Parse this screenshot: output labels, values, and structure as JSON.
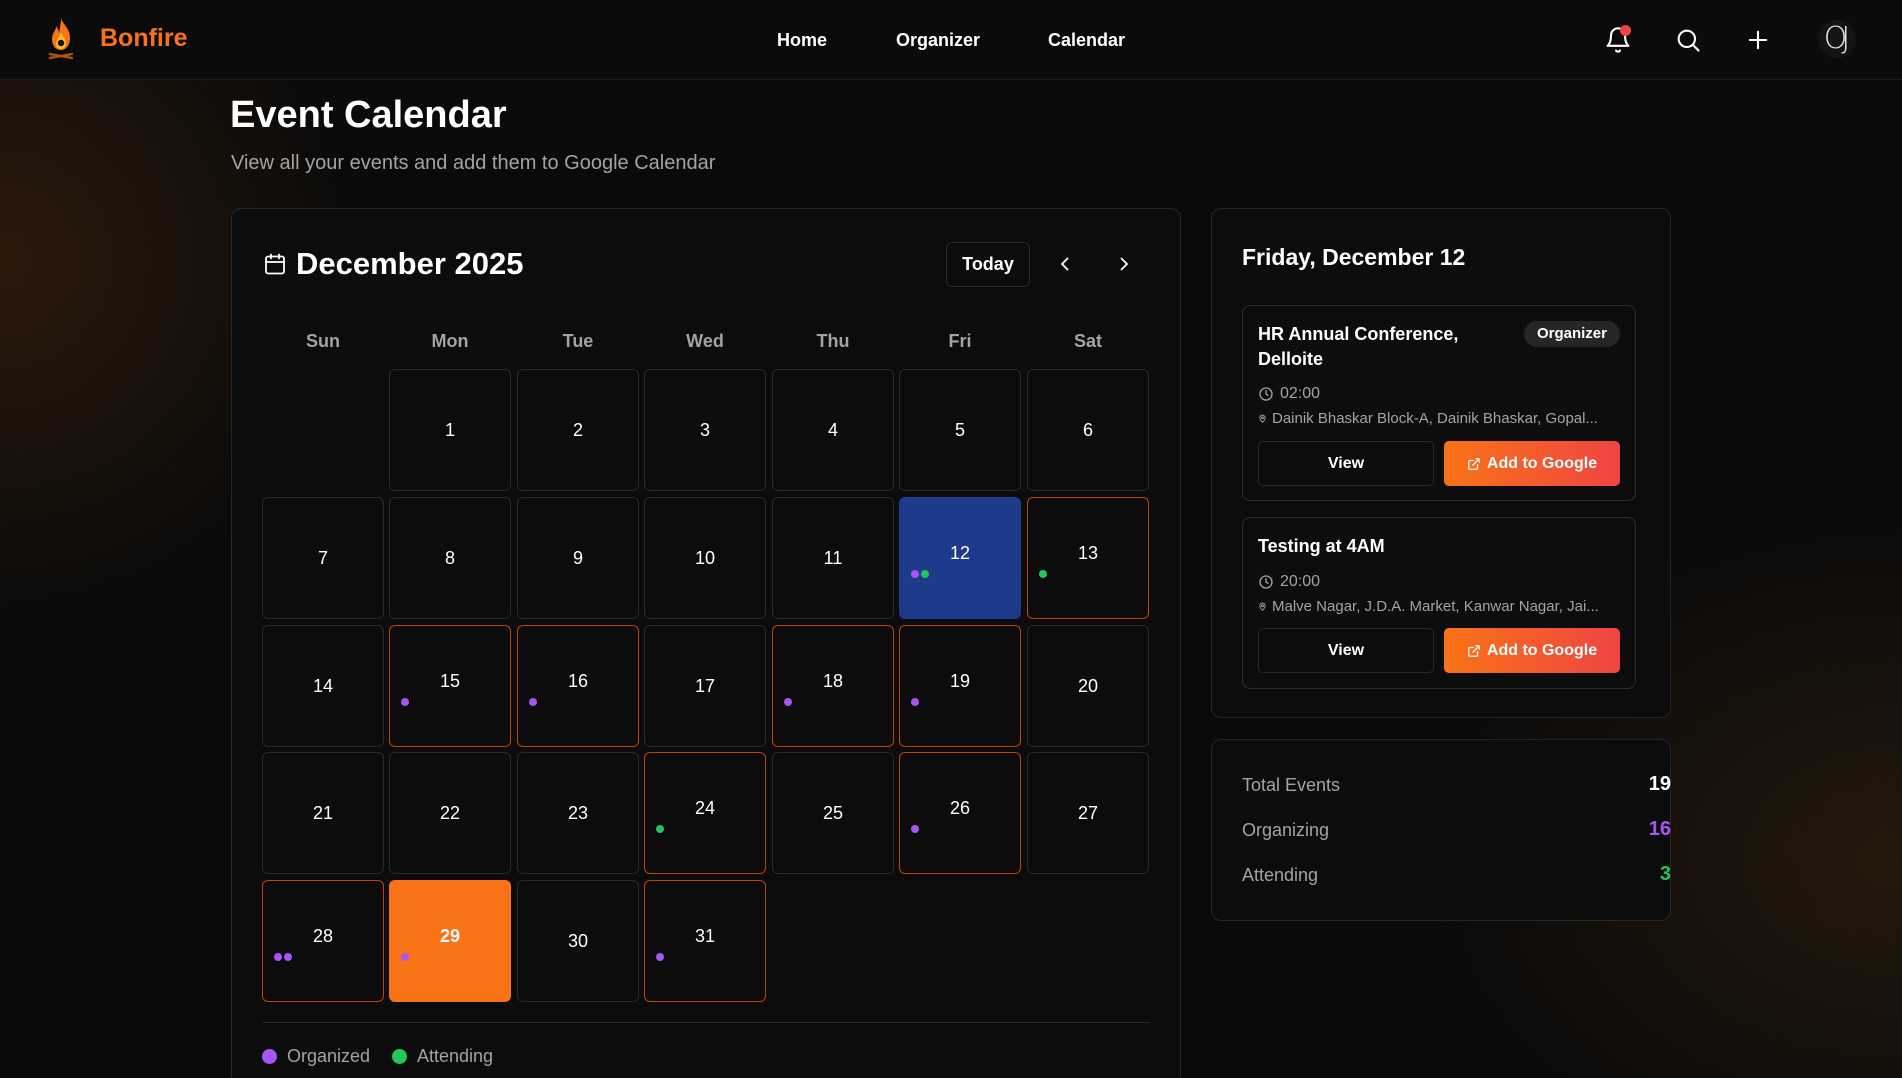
{
  "app": {
    "brand": "Bonfire"
  },
  "nav": {
    "links": [
      "Home",
      "Organizer",
      "Calendar"
    ],
    "icons": [
      "bell-icon",
      "search-icon",
      "plus-icon"
    ],
    "avatar_initials": "OJ"
  },
  "header": {
    "title": "Event Calendar",
    "subtitle": "View all your events and add them to Google Calendar"
  },
  "calendar": {
    "month_label": "December 2025",
    "today_label": "Today",
    "weekdays": [
      "Sun",
      "Mon",
      "Tue",
      "Wed",
      "Thu",
      "Fri",
      "Sat"
    ],
    "first_weekday_index": 1,
    "days_in_month": 31,
    "selected_day": 12,
    "today_day": 29,
    "days_with_events": {
      "12": [
        "organized",
        "attending"
      ],
      "13": [
        "attending"
      ],
      "15": [
        "organized"
      ],
      "16": [
        "organized"
      ],
      "18": [
        "organized"
      ],
      "19": [
        "organized"
      ],
      "24": [
        "attending"
      ],
      "26": [
        "organized"
      ],
      "28": [
        "organized",
        "organized"
      ],
      "29": [
        "organized"
      ],
      "31": [
        "organized"
      ]
    },
    "legend": {
      "organized": "Organized",
      "attending": "Attending"
    }
  },
  "selected": {
    "date_label": "Friday, December 12",
    "events": [
      {
        "title": "HR Annual Conference, Delloite",
        "badge": "Organizer",
        "time": "02:00",
        "location": "Dainik Bhaskar Block-A, Dainik Bhaskar, Gopal...",
        "view_label": "View",
        "google_label": "Add to Google"
      },
      {
        "title": "Testing at 4AM",
        "time": "20:00",
        "location": "Malve Nagar, J.D.A. Market, Kanwar Nagar, Jai...",
        "view_label": "View",
        "google_label": "Add to Google"
      }
    ]
  },
  "stats": {
    "total_label": "Total Events",
    "total_value": "19",
    "organizing_label": "Organizing",
    "organizing_value": "16",
    "attending_label": "Attending",
    "attending_value": "3"
  },
  "colors": {
    "accent": "#f97316",
    "selected": "#1e3a8a",
    "organized": "#a855f7",
    "attending": "#22c55e",
    "notification": "#ef4444"
  }
}
